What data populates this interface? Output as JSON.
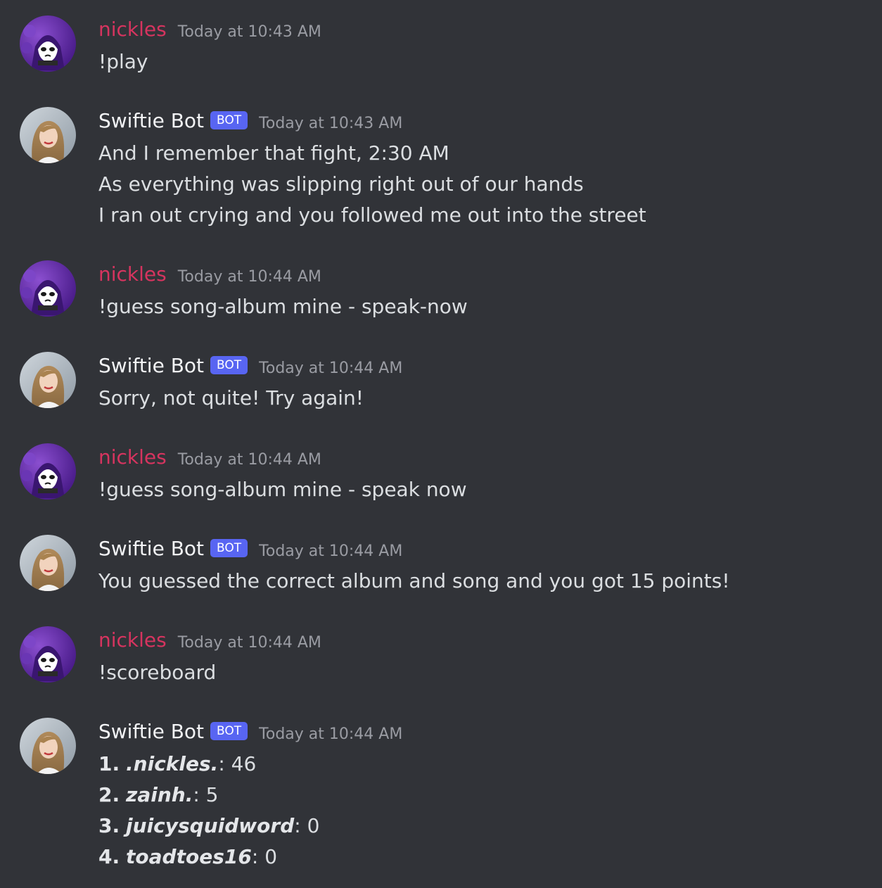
{
  "users": {
    "nickles": "nickles",
    "bot": "Swiftie Bot",
    "bot_tag": "BOT"
  },
  "colors": {
    "background": "#313338",
    "nickles_name": "#d6345f",
    "bot_tag": "#5865f2",
    "text": "#dbdee1",
    "timestamp": "#9a9ca3"
  },
  "messages": [
    {
      "author": "nickles",
      "timestamp": "Today at 10:43 AM",
      "lines": [
        "!play"
      ]
    },
    {
      "author": "Swiftie Bot",
      "timestamp": "Today at 10:43 AM",
      "lines": [
        "And I remember that fight, 2:30 AM",
        "As everything was slipping right out of our hands",
        "I ran out crying and you followed me out into the street"
      ]
    },
    {
      "author": "nickles",
      "timestamp": "Today at 10:44 AM",
      "lines": [
        "!guess song-album mine - speak-now"
      ]
    },
    {
      "author": "Swiftie Bot",
      "timestamp": "Today at 10:44 AM",
      "lines": [
        "Sorry, not quite! Try again!"
      ]
    },
    {
      "author": "nickles",
      "timestamp": "Today at 10:44 AM",
      "lines": [
        "!guess song-album mine - speak now"
      ]
    },
    {
      "author": "Swiftie Bot",
      "timestamp": "Today at 10:44 AM",
      "lines": [
        "You guessed the correct album and song and you got 15 points!"
      ]
    },
    {
      "author": "nickles",
      "timestamp": "Today at 10:44 AM",
      "lines": [
        "!scoreboard"
      ]
    },
    {
      "author": "Swiftie Bot",
      "timestamp": "Today at 10:44 AM",
      "scoreboard": [
        {
          "rank": "1.",
          "name": ".nickles.",
          "score": "46"
        },
        {
          "rank": "2.",
          "name": "zainh.",
          "score": "5"
        },
        {
          "rank": "3.",
          "name": "juicysquidword",
          "score": "0"
        },
        {
          "rank": "4.",
          "name": "toadtoes16",
          "score": "0"
        }
      ]
    }
  ]
}
